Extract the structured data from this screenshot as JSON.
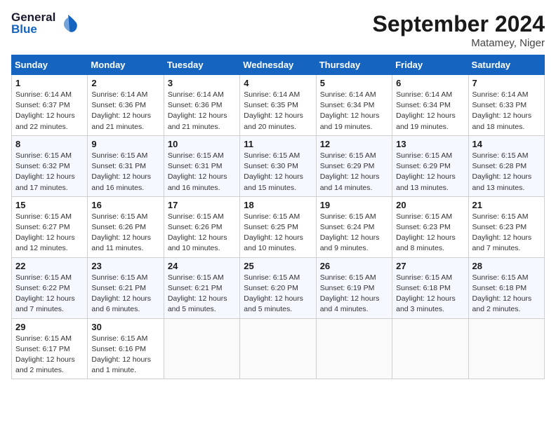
{
  "header": {
    "logo_line1": "General",
    "logo_line2": "Blue",
    "month": "September 2024",
    "location": "Matamey, Niger"
  },
  "weekdays": [
    "Sunday",
    "Monday",
    "Tuesday",
    "Wednesday",
    "Thursday",
    "Friday",
    "Saturday"
  ],
  "weeks": [
    [
      {
        "day": "1",
        "info": "Sunrise: 6:14 AM\nSunset: 6:37 PM\nDaylight: 12 hours\nand 22 minutes."
      },
      {
        "day": "2",
        "info": "Sunrise: 6:14 AM\nSunset: 6:36 PM\nDaylight: 12 hours\nand 21 minutes."
      },
      {
        "day": "3",
        "info": "Sunrise: 6:14 AM\nSunset: 6:36 PM\nDaylight: 12 hours\nand 21 minutes."
      },
      {
        "day": "4",
        "info": "Sunrise: 6:14 AM\nSunset: 6:35 PM\nDaylight: 12 hours\nand 20 minutes."
      },
      {
        "day": "5",
        "info": "Sunrise: 6:14 AM\nSunset: 6:34 PM\nDaylight: 12 hours\nand 19 minutes."
      },
      {
        "day": "6",
        "info": "Sunrise: 6:14 AM\nSunset: 6:34 PM\nDaylight: 12 hours\nand 19 minutes."
      },
      {
        "day": "7",
        "info": "Sunrise: 6:14 AM\nSunset: 6:33 PM\nDaylight: 12 hours\nand 18 minutes."
      }
    ],
    [
      {
        "day": "8",
        "info": "Sunrise: 6:15 AM\nSunset: 6:32 PM\nDaylight: 12 hours\nand 17 minutes."
      },
      {
        "day": "9",
        "info": "Sunrise: 6:15 AM\nSunset: 6:31 PM\nDaylight: 12 hours\nand 16 minutes."
      },
      {
        "day": "10",
        "info": "Sunrise: 6:15 AM\nSunset: 6:31 PM\nDaylight: 12 hours\nand 16 minutes."
      },
      {
        "day": "11",
        "info": "Sunrise: 6:15 AM\nSunset: 6:30 PM\nDaylight: 12 hours\nand 15 minutes."
      },
      {
        "day": "12",
        "info": "Sunrise: 6:15 AM\nSunset: 6:29 PM\nDaylight: 12 hours\nand 14 minutes."
      },
      {
        "day": "13",
        "info": "Sunrise: 6:15 AM\nSunset: 6:29 PM\nDaylight: 12 hours\nand 13 minutes."
      },
      {
        "day": "14",
        "info": "Sunrise: 6:15 AM\nSunset: 6:28 PM\nDaylight: 12 hours\nand 13 minutes."
      }
    ],
    [
      {
        "day": "15",
        "info": "Sunrise: 6:15 AM\nSunset: 6:27 PM\nDaylight: 12 hours\nand 12 minutes."
      },
      {
        "day": "16",
        "info": "Sunrise: 6:15 AM\nSunset: 6:26 PM\nDaylight: 12 hours\nand 11 minutes."
      },
      {
        "day": "17",
        "info": "Sunrise: 6:15 AM\nSunset: 6:26 PM\nDaylight: 12 hours\nand 10 minutes."
      },
      {
        "day": "18",
        "info": "Sunrise: 6:15 AM\nSunset: 6:25 PM\nDaylight: 12 hours\nand 10 minutes."
      },
      {
        "day": "19",
        "info": "Sunrise: 6:15 AM\nSunset: 6:24 PM\nDaylight: 12 hours\nand 9 minutes."
      },
      {
        "day": "20",
        "info": "Sunrise: 6:15 AM\nSunset: 6:23 PM\nDaylight: 12 hours\nand 8 minutes."
      },
      {
        "day": "21",
        "info": "Sunrise: 6:15 AM\nSunset: 6:23 PM\nDaylight: 12 hours\nand 7 minutes."
      }
    ],
    [
      {
        "day": "22",
        "info": "Sunrise: 6:15 AM\nSunset: 6:22 PM\nDaylight: 12 hours\nand 7 minutes."
      },
      {
        "day": "23",
        "info": "Sunrise: 6:15 AM\nSunset: 6:21 PM\nDaylight: 12 hours\nand 6 minutes."
      },
      {
        "day": "24",
        "info": "Sunrise: 6:15 AM\nSunset: 6:21 PM\nDaylight: 12 hours\nand 5 minutes."
      },
      {
        "day": "25",
        "info": "Sunrise: 6:15 AM\nSunset: 6:20 PM\nDaylight: 12 hours\nand 5 minutes."
      },
      {
        "day": "26",
        "info": "Sunrise: 6:15 AM\nSunset: 6:19 PM\nDaylight: 12 hours\nand 4 minutes."
      },
      {
        "day": "27",
        "info": "Sunrise: 6:15 AM\nSunset: 6:18 PM\nDaylight: 12 hours\nand 3 minutes."
      },
      {
        "day": "28",
        "info": "Sunrise: 6:15 AM\nSunset: 6:18 PM\nDaylight: 12 hours\nand 2 minutes."
      }
    ],
    [
      {
        "day": "29",
        "info": "Sunrise: 6:15 AM\nSunset: 6:17 PM\nDaylight: 12 hours\nand 2 minutes."
      },
      {
        "day": "30",
        "info": "Sunrise: 6:15 AM\nSunset: 6:16 PM\nDaylight: 12 hours\nand 1 minute."
      },
      {
        "day": "",
        "info": ""
      },
      {
        "day": "",
        "info": ""
      },
      {
        "day": "",
        "info": ""
      },
      {
        "day": "",
        "info": ""
      },
      {
        "day": "",
        "info": ""
      }
    ]
  ]
}
